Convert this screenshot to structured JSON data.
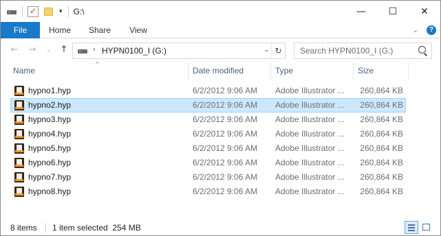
{
  "titlebar": {
    "title": "G:\\",
    "qat_icons": [
      "drive-icon",
      "properties-icon",
      "new-folder-icon"
    ],
    "dropdown_glyph": "▾",
    "controls": {
      "minimize": "—",
      "maximize": "☐",
      "close": "✕"
    }
  },
  "ribbon": {
    "tabs": [
      "File",
      "Home",
      "Share",
      "View"
    ],
    "active_tab_color": "#1979ca",
    "expand_glyph": "⌄",
    "help_glyph": "?"
  },
  "nav": {
    "back": "←",
    "forward": "→",
    "history": "⌄",
    "up": "↑",
    "address_separator": "›",
    "address": "HYPN0100_I (G:)",
    "address_dropdown": "⌄",
    "refresh": "↻",
    "search_placeholder": "Search HYPN0100_I (G:)"
  },
  "columns": {
    "sort_glyph": "^",
    "name": "Name",
    "date": "Date modified",
    "type": "Type",
    "size": "Size"
  },
  "files": [
    {
      "name": "hypno1.hyp",
      "date": "6/2/2012 9:06 AM",
      "type": "Adobe Illustrator ...",
      "size": "260,864 KB",
      "selected": false
    },
    {
      "name": "hypno2.hyp",
      "date": "6/2/2012 9:06 AM",
      "type": "Adobe Illustrator ...",
      "size": "260,864 KB",
      "selected": true
    },
    {
      "name": "hypno3.hyp",
      "date": "6/2/2012 9:06 AM",
      "type": "Adobe Illustrator ...",
      "size": "260,864 KB",
      "selected": false
    },
    {
      "name": "hypno4.hyp",
      "date": "6/2/2012 9:06 AM",
      "type": "Adobe Illustrator ...",
      "size": "260,864 KB",
      "selected": false
    },
    {
      "name": "hypno5.hyp",
      "date": "6/2/2012 9:06 AM",
      "type": "Adobe Illustrator ...",
      "size": "260,864 KB",
      "selected": false
    },
    {
      "name": "hypno6.hyp",
      "date": "6/2/2012 9:06 AM",
      "type": "Adobe Illustrator ...",
      "size": "260,864 KB",
      "selected": false
    },
    {
      "name": "hypno7.hyp",
      "date": "6/2/2012 9:06 AM",
      "type": "Adobe Illustrator ...",
      "size": "260,864 KB",
      "selected": false
    },
    {
      "name": "hypno8.hyp",
      "date": "6/2/2012 9:06 AM",
      "type": "Adobe Illustrator ...",
      "size": "260,864 KB",
      "selected": false
    }
  ],
  "status": {
    "item_count": "8 items",
    "selection": "1 item selected  254 MB"
  },
  "colors": {
    "selection_bg": "#cce8ff",
    "selection_border": "#99d1ff",
    "header_text": "#4c607a"
  }
}
